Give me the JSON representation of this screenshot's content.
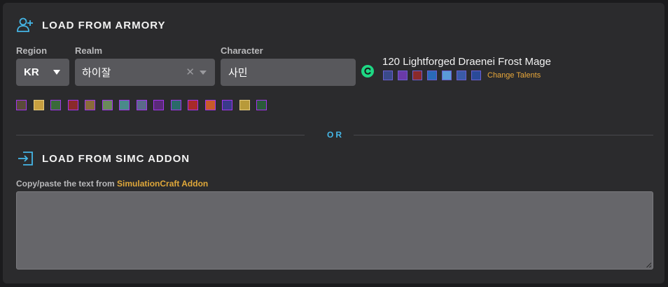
{
  "armory": {
    "title": "LOAD FROM ARMORY",
    "region_label": "Region",
    "region_value": "KR",
    "realm_label": "Realm",
    "realm_value": "하이잘",
    "character_label": "Character",
    "character_value": "사민",
    "character_summary": "120 Lightforged Draenei Frost Mage",
    "change_talents_label": "Change Talents",
    "talent_icons": [
      {
        "name": "skull-talent-icon",
        "color": "#3a4a8a"
      },
      {
        "name": "arcane-talent-icon",
        "color": "#6a3aa8"
      },
      {
        "name": "fire-hand-talent-icon",
        "color": "#8a2a2a"
      },
      {
        "name": "ice-shard-talent-icon",
        "color": "#2a6ab8"
      },
      {
        "name": "frost-ray-talent-icon",
        "color": "#5a9ad8"
      },
      {
        "name": "glacial-talent-icon",
        "color": "#3a5aa8"
      },
      {
        "name": "comet-talent-icon",
        "color": "#2a4a98"
      }
    ],
    "gear_icons": [
      {
        "name": "helm-gear-icon",
        "color": "#5a4a3a",
        "quality": "epic"
      },
      {
        "name": "neck-gear-icon",
        "color": "#c8a040",
        "quality": "legendary"
      },
      {
        "name": "shoulder-gear-icon",
        "color": "#3a6a3a",
        "quality": "epic"
      },
      {
        "name": "cloak-gear-icon",
        "color": "#8a2a2a",
        "quality": "epic"
      },
      {
        "name": "chest-gear-icon",
        "color": "#8a6a3a",
        "quality": "epic"
      },
      {
        "name": "wrist-gear-icon",
        "color": "#6a8a5a",
        "quality": "epic"
      },
      {
        "name": "hands-gear-icon",
        "color": "#4a8a8a",
        "quality": "epic"
      },
      {
        "name": "waist-gear-icon",
        "color": "#5a6a8a",
        "quality": "epic"
      },
      {
        "name": "legs-gear-icon",
        "color": "#5a2a7a",
        "quality": "epic"
      },
      {
        "name": "feet-gear-icon",
        "color": "#2a6a6a",
        "quality": "epic"
      },
      {
        "name": "ring1-gear-icon",
        "color": "#a82a2a",
        "quality": "epic"
      },
      {
        "name": "ring2-gear-icon",
        "color": "#c85a2a",
        "quality": "epic"
      },
      {
        "name": "trinket1-gear-icon",
        "color": "#3a3a8a",
        "quality": "epic"
      },
      {
        "name": "trinket2-gear-icon",
        "color": "#b89a3a",
        "quality": "epic"
      },
      {
        "name": "weapon-gear-icon",
        "color": "#2a5a3a",
        "quality": "epic"
      }
    ]
  },
  "divider": {
    "text": "OR"
  },
  "addon": {
    "title": "LOAD FROM SIMC ADDON",
    "instruction_prefix": "Copy/paste the text from ",
    "instruction_link": "SimulationCraft Addon",
    "textarea_value": ""
  },
  "colors": {
    "accent_blue": "#45b6e6",
    "link_orange": "#e0a83a",
    "refresh_green": "#1ed884",
    "epic_purple": "#a335ee"
  }
}
